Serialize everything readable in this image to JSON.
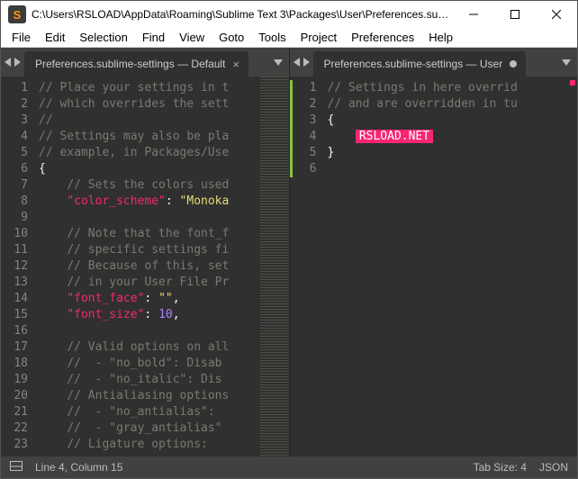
{
  "window": {
    "title": "C:\\Users\\RSLOAD\\AppData\\Roaming\\Sublime Text 3\\Packages\\User\\Preferences.subli..."
  },
  "menubar": {
    "items": [
      "File",
      "Edit",
      "Selection",
      "Find",
      "View",
      "Goto",
      "Tools",
      "Project",
      "Preferences",
      "Help"
    ]
  },
  "panes": {
    "left": {
      "tab_label": "Preferences.sublime-settings — Default",
      "tab_dirty": false,
      "lines": [
        {
          "n": 1,
          "tokens": [
            {
              "cls": "c-comment",
              "t": "// Place your settings in t"
            }
          ]
        },
        {
          "n": 2,
          "tokens": [
            {
              "cls": "c-comment",
              "t": "// which overrides the sett"
            }
          ]
        },
        {
          "n": 3,
          "tokens": [
            {
              "cls": "c-comment",
              "t": "//"
            }
          ]
        },
        {
          "n": 4,
          "tokens": [
            {
              "cls": "c-comment",
              "t": "// Settings may also be pla"
            }
          ]
        },
        {
          "n": 5,
          "tokens": [
            {
              "cls": "c-comment",
              "t": "// example, in Packages/Use"
            }
          ]
        },
        {
          "n": 6,
          "tokens": [
            {
              "cls": "c-brace",
              "t": "{"
            }
          ]
        },
        {
          "n": 7,
          "tokens": [
            {
              "cls": "",
              "t": "    "
            },
            {
              "cls": "c-comment",
              "t": "// Sets the colors used"
            }
          ]
        },
        {
          "n": 8,
          "tokens": [
            {
              "cls": "",
              "t": "    "
            },
            {
              "cls": "c-key",
              "t": "\"color_scheme\""
            },
            {
              "cls": "c-punc",
              "t": ": "
            },
            {
              "cls": "c-str",
              "t": "\"Monoka"
            }
          ]
        },
        {
          "n": 9,
          "tokens": [
            {
              "cls": "",
              "t": ""
            }
          ]
        },
        {
          "n": 10,
          "tokens": [
            {
              "cls": "",
              "t": "    "
            },
            {
              "cls": "c-comment",
              "t": "// Note that the font_f"
            }
          ]
        },
        {
          "n": 11,
          "tokens": [
            {
              "cls": "",
              "t": "    "
            },
            {
              "cls": "c-comment",
              "t": "// specific settings fi"
            }
          ]
        },
        {
          "n": 12,
          "tokens": [
            {
              "cls": "",
              "t": "    "
            },
            {
              "cls": "c-comment",
              "t": "// Because of this, set"
            }
          ]
        },
        {
          "n": 13,
          "tokens": [
            {
              "cls": "",
              "t": "    "
            },
            {
              "cls": "c-comment",
              "t": "// in your User File Pr"
            }
          ]
        },
        {
          "n": 14,
          "tokens": [
            {
              "cls": "",
              "t": "    "
            },
            {
              "cls": "c-key",
              "t": "\"font_face\""
            },
            {
              "cls": "c-punc",
              "t": ": "
            },
            {
              "cls": "c-str",
              "t": "\"\""
            },
            {
              "cls": "c-punc",
              "t": ","
            }
          ]
        },
        {
          "n": 15,
          "tokens": [
            {
              "cls": "",
              "t": "    "
            },
            {
              "cls": "c-key",
              "t": "\"font_size\""
            },
            {
              "cls": "c-punc",
              "t": ": "
            },
            {
              "cls": "c-num",
              "t": "10"
            },
            {
              "cls": "c-punc",
              "t": ","
            }
          ]
        },
        {
          "n": 16,
          "tokens": [
            {
              "cls": "",
              "t": ""
            }
          ]
        },
        {
          "n": 17,
          "tokens": [
            {
              "cls": "",
              "t": "    "
            },
            {
              "cls": "c-comment",
              "t": "// Valid options on all"
            }
          ]
        },
        {
          "n": 18,
          "tokens": [
            {
              "cls": "",
              "t": "    "
            },
            {
              "cls": "c-comment",
              "t": "//  - \"no_bold\": Disab"
            }
          ]
        },
        {
          "n": 19,
          "tokens": [
            {
              "cls": "",
              "t": "    "
            },
            {
              "cls": "c-comment",
              "t": "//  - \"no_italic\": Dis"
            }
          ]
        },
        {
          "n": 20,
          "tokens": [
            {
              "cls": "",
              "t": "    "
            },
            {
              "cls": "c-comment",
              "t": "// Antialiasing options"
            }
          ]
        },
        {
          "n": 21,
          "tokens": [
            {
              "cls": "",
              "t": "    "
            },
            {
              "cls": "c-comment",
              "t": "//  - \"no_antialias\": "
            }
          ]
        },
        {
          "n": 22,
          "tokens": [
            {
              "cls": "",
              "t": "    "
            },
            {
              "cls": "c-comment",
              "t": "//  - \"gray_antialias\""
            }
          ]
        },
        {
          "n": 23,
          "tokens": [
            {
              "cls": "",
              "t": "    "
            },
            {
              "cls": "c-comment",
              "t": "// Ligature options:"
            }
          ]
        }
      ]
    },
    "right": {
      "tab_label": "Preferences.sublime-settings — User",
      "tab_dirty": true,
      "highlight_text": "RSLOAD.NET",
      "lines": [
        {
          "n": 1,
          "tokens": [
            {
              "cls": "c-comment",
              "t": "// Settings in here overrid"
            }
          ]
        },
        {
          "n": 2,
          "tokens": [
            {
              "cls": "c-comment",
              "t": "// and are overridden in tu"
            }
          ]
        },
        {
          "n": 3,
          "tokens": [
            {
              "cls": "c-brace",
              "t": "{"
            }
          ]
        },
        {
          "n": 4,
          "tokens": [
            {
              "cls": "",
              "t": "    "
            },
            {
              "cls": "highlight-box",
              "t": "RSLOAD.NET"
            }
          ]
        },
        {
          "n": 5,
          "tokens": [
            {
              "cls": "c-brace",
              "t": "}"
            }
          ]
        },
        {
          "n": 6,
          "tokens": [
            {
              "cls": "",
              "t": ""
            }
          ]
        }
      ]
    }
  },
  "statusbar": {
    "position": "Line 4, Column 15",
    "tab_size": "Tab Size: 4",
    "syntax": "JSON"
  }
}
